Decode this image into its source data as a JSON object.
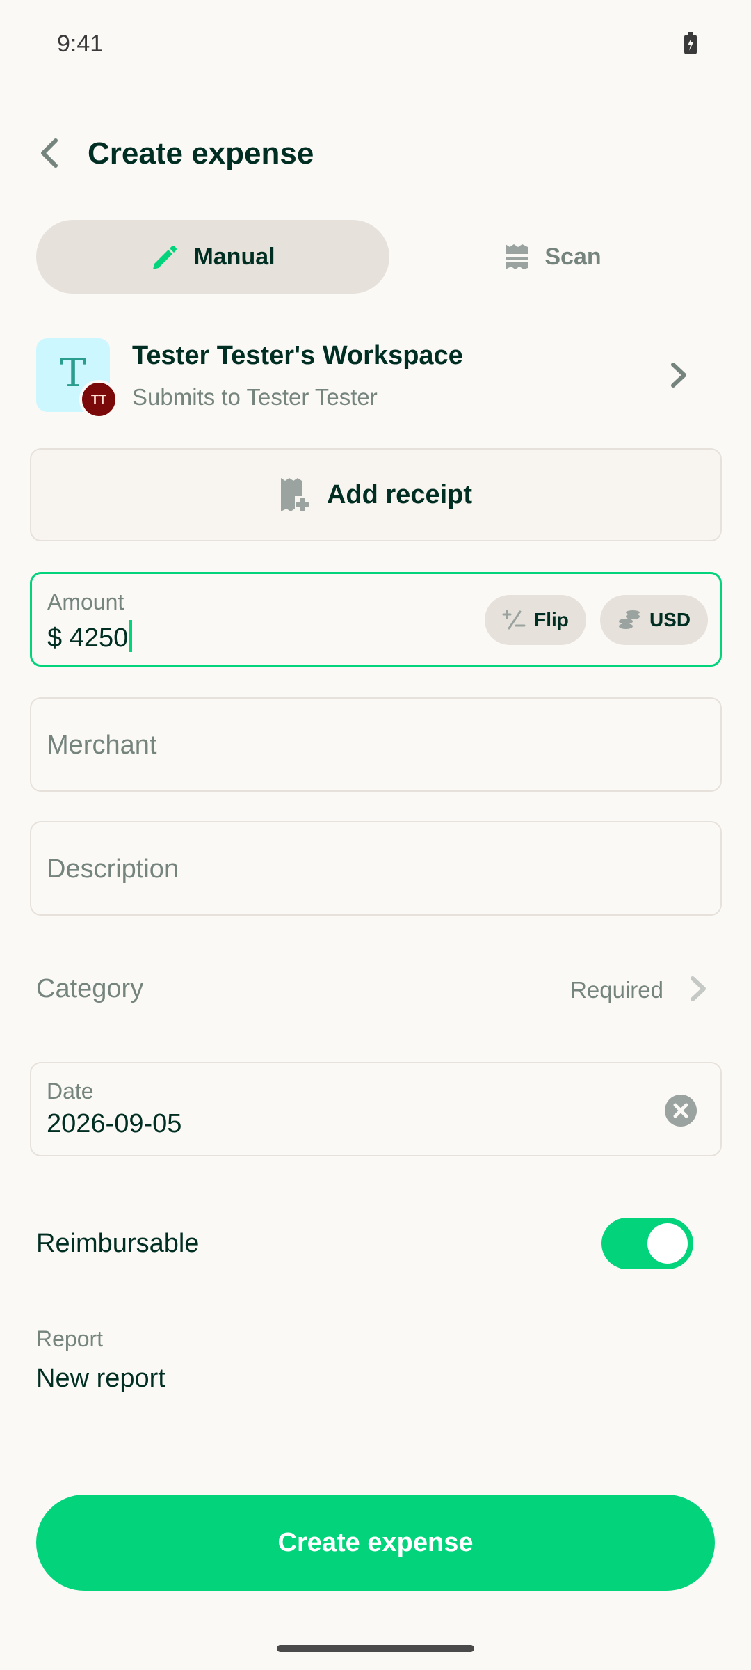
{
  "status_bar": {
    "time": "9:41"
  },
  "header": {
    "title": "Create expense"
  },
  "tabs": [
    {
      "label": "Manual",
      "icon": "pencil-icon",
      "selected": true
    },
    {
      "label": "Scan",
      "icon": "receipt-scan-icon",
      "selected": false
    }
  ],
  "workspace": {
    "avatar_letter": "T",
    "submitter_initials": "TT",
    "name": "Tester Tester's Workspace",
    "submits_to": "Submits to Tester Tester"
  },
  "receipt": {
    "label": "Add receipt"
  },
  "amount": {
    "label": "Amount",
    "currency_symbol": "$",
    "value": "4250",
    "flip_label": "Flip",
    "currency_label": "USD"
  },
  "merchant": {
    "placeholder": "Merchant"
  },
  "description": {
    "placeholder": "Description"
  },
  "category": {
    "label": "Category",
    "status": "Required"
  },
  "date": {
    "label": "Date",
    "value": "2026-09-05"
  },
  "reimbursable": {
    "label": "Reimbursable",
    "enabled": true
  },
  "report": {
    "label": "Report",
    "value": "New report"
  },
  "submit": {
    "label": "Create expense"
  },
  "colors": {
    "accent": "#03D47C",
    "text": "#002E22",
    "muted": "#76847E",
    "border": "#E6E1DA",
    "background": "#FBF9F6"
  }
}
